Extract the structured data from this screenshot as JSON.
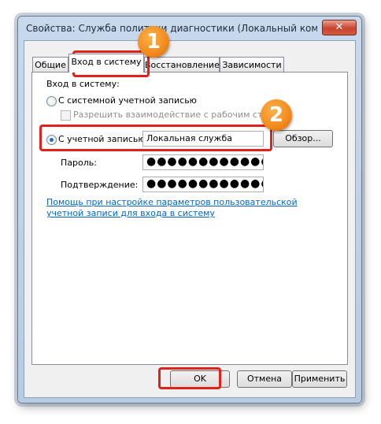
{
  "window": {
    "title": "Свойства: Служба политики диагностики (Локальный компьютер)",
    "close_glyph": "✕"
  },
  "tabs": [
    {
      "label": "Общие"
    },
    {
      "label": "Вход в систему"
    },
    {
      "label": "Восстановление"
    },
    {
      "label": "Зависимости"
    }
  ],
  "logon": {
    "group_label": "Вход в систему:",
    "system_account_label": "С системной учетной записью",
    "allow_desktop_label": "Разрешить взаимодействие с рабочим столом",
    "this_account_label": "С учетной записью:",
    "account_value": "Локальная служба",
    "browse_label": "Обзор...",
    "password_label": "Пароль:",
    "password_value": "●●●●●●●●●●●●●●●",
    "confirm_label": "Подтверждение:",
    "confirm_value": "●●●●●●●●●●●●●●●",
    "help_link": "Помощь при настройке параметров пользовательской учетной записи для входа в систему"
  },
  "footer": {
    "ok_label": "OK",
    "cancel_label": "Отмена",
    "apply_label": "Применить"
  },
  "annotations": {
    "badge_1": "1",
    "badge_2": "2",
    "highlight_color": "#e2201c",
    "badge_color": "#f28a1b"
  }
}
